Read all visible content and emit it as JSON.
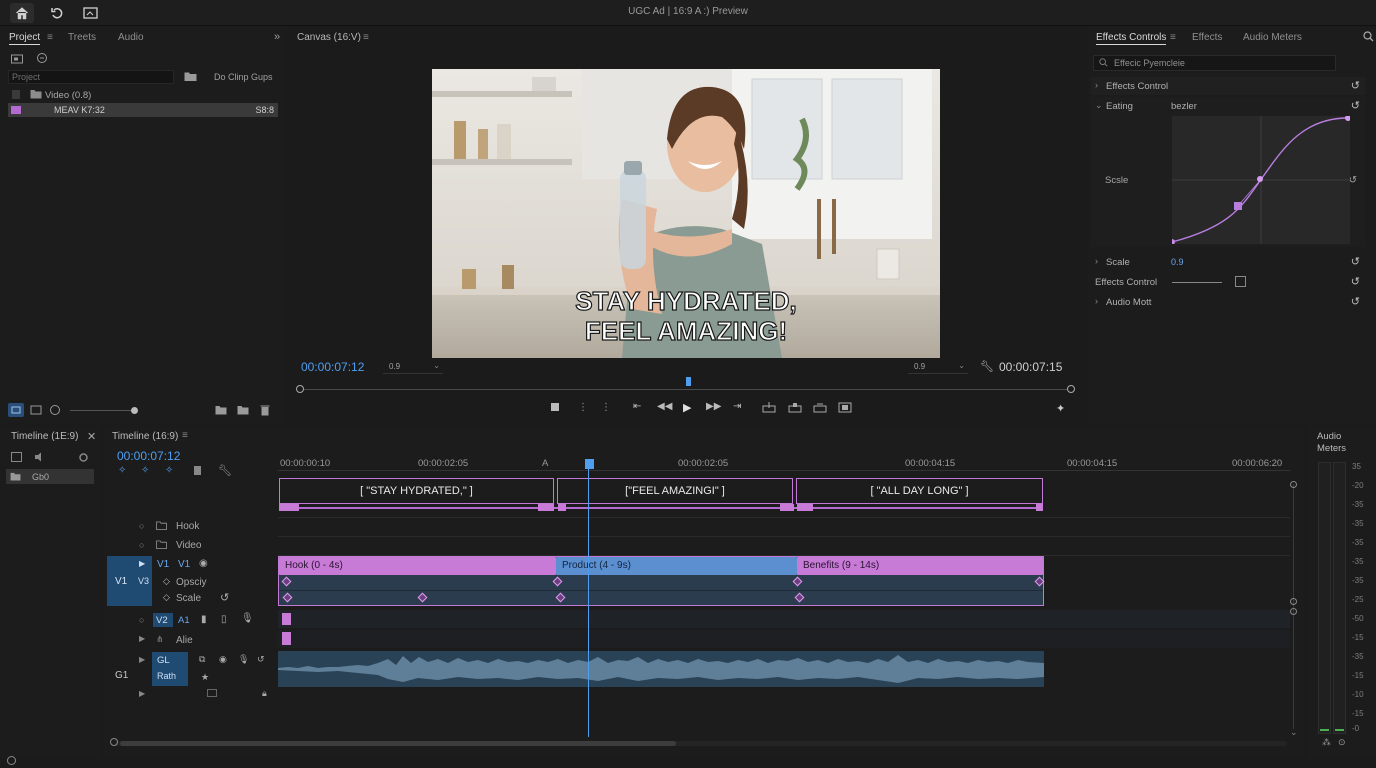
{
  "window": {
    "title": "UGC Ad | 16:9 A :) Preview"
  },
  "topbar": {
    "icons": [
      "home-icon",
      "undo-icon",
      "layout-icon"
    ]
  },
  "project_panel": {
    "tabs": [
      "Project",
      "Treets",
      "Audio"
    ],
    "search_placeholder": "Project",
    "drop_label": "Do Clinp Gups",
    "items": [
      {
        "name": "Video (0.8)",
        "value": ""
      },
      {
        "name": "MEAV K7:32",
        "value": "S8:8"
      }
    ]
  },
  "canvas": {
    "title": "Canvas (16:V)",
    "overlay_line1": "STAY HYDRATED,",
    "overlay_line2": "FEEL AMAZING!",
    "timecode_left": "00:00:07:12",
    "timecode_right": "00:00:07:15",
    "zoom_left": "0.9",
    "zoom_right": "0.9"
  },
  "effects": {
    "tabs": [
      "Effects Controls",
      "Effects",
      "Audio Meters"
    ],
    "search_placeholder": "Effecic Pyemcleie",
    "rows": {
      "effects_control": "Effects Control",
      "easing": "Eating",
      "easing_value": "bezler",
      "scale_curve": "Scsle",
      "scale": "Scale",
      "scale_value": "0.9",
      "effects_control2": "Effects Control",
      "audio": "Audio Mott"
    }
  },
  "timeline": {
    "left_tab": "Timeline (1E:9)",
    "center_tab": "Timeline (16:9)",
    "timecode": "00:00:07:12",
    "left_item": "Gb0",
    "ruler": [
      "00:00:00:10",
      "00:00:02:05",
      "A",
      "00:00:02:05",
      "00:00:04:15",
      "00:00:04:15",
      "00:00:06:20"
    ],
    "captions": [
      "[ \"STAY HYDRATED,\" ]",
      "[\"FEEL AMAZINGI\" ]",
      "[ \"ALL DAY LONG\" ]"
    ],
    "track_labels": {
      "hook": "Hook",
      "video": "Video",
      "v1_outer": "V1",
      "v1a": "V1",
      "v1b": "V1",
      "v3": "V3",
      "opacity": "Opsciy",
      "scale": "Scale",
      "v2": "V2",
      "a1": "A1",
      "alie": "Alie",
      "g1": "G1",
      "gl": "GL",
      "rath": "Rath"
    },
    "clips": [
      {
        "label": "Hook (0 - 4s)",
        "color": "#c77ad6"
      },
      {
        "label": "Product (4 - 9s)",
        "color": "#5b8fd0"
      },
      {
        "label": "Benefits (9 - 14s)",
        "color": "#c77ad6"
      }
    ]
  },
  "audio_meters": {
    "title_line1": "Audio",
    "title_line2": "Meters",
    "scale": [
      "35",
      "-20",
      "-35",
      "-35",
      "-35",
      "-35",
      "-35",
      "-25",
      "-50",
      "-15",
      "-35",
      "-15",
      "-10",
      "-15",
      "-0"
    ]
  },
  "colors": {
    "accent": "#c77ad6",
    "blue": "#5b8fd0",
    "playhead": "#4f9ef0"
  }
}
